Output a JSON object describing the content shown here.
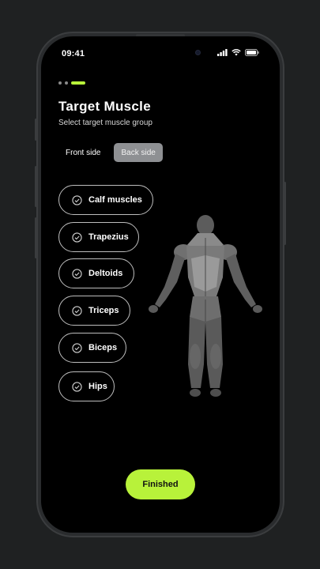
{
  "status": {
    "time": "09:41"
  },
  "header": {
    "title": "Target Muscle",
    "subtitle": "Select target muscle group"
  },
  "side_toggle": {
    "front_label": "Front side",
    "back_label": "Back side",
    "selected": "Back side"
  },
  "muscles": [
    {
      "label": "Calf muscles",
      "icon": "check-circle-icon"
    },
    {
      "label": "Trapezius",
      "icon": "check-circle-icon"
    },
    {
      "label": "Deltoids",
      "icon": "check-circle-icon"
    },
    {
      "label": "Triceps",
      "icon": "check-circle-icon"
    },
    {
      "label": "Biceps",
      "icon": "check-circle-icon"
    },
    {
      "label": "Hips",
      "icon": "check-circle-icon"
    }
  ],
  "actions": {
    "finish_label": "Finished"
  },
  "colors": {
    "accent": "#b8f23a",
    "background": "#000000",
    "frame": "#2a2c2e",
    "toggle_active": "#8e9093",
    "body_base": "#5a5a5a",
    "body_highlight": "#9a9a9a"
  },
  "progress": {
    "current_step": 3,
    "total_steps": 3
  }
}
